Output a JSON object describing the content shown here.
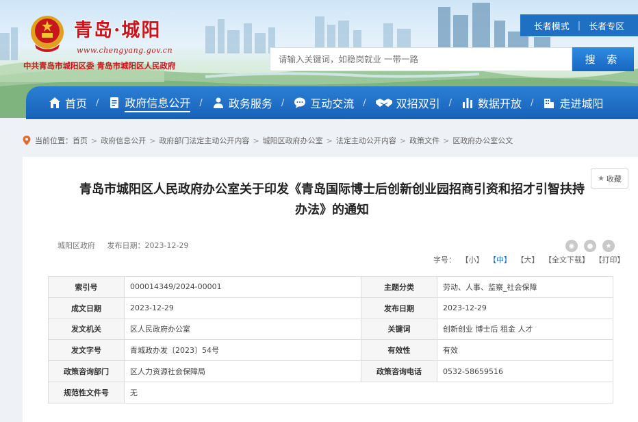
{
  "header": {
    "site_title": "青岛·城阳",
    "site_url": "www.chengyang.gov.cn",
    "site_sub": "中共青岛市城阳区委  青岛市城阳区人民政府",
    "elder_mode": "长者模式",
    "elder_zone": "长者专区",
    "search_placeholder": "请输入关键词，如稳岗就业 一带一路",
    "search_button": "搜 索"
  },
  "nav": {
    "items": [
      {
        "label": "首页",
        "icon": "home-icon"
      },
      {
        "label": "政府信息公开",
        "icon": "document-icon"
      },
      {
        "label": "政务服务",
        "icon": "service-icon"
      },
      {
        "label": "互动交流",
        "icon": "chat-icon"
      },
      {
        "label": "双招双引",
        "icon": "handshake-icon"
      },
      {
        "label": "数据开放",
        "icon": "bar-chart-icon"
      },
      {
        "label": "走进城阳",
        "icon": "building-icon"
      }
    ],
    "active_index": 1
  },
  "breadcrumb": {
    "prefix": "当前位置：",
    "items": [
      "首页",
      "政府信息公开",
      "政府部门法定主动公开内容",
      "城阳区政府办公室",
      "法定主动公开内容",
      "政策文件",
      "区政府办公室公文"
    ]
  },
  "article": {
    "title": "青岛市城阳区人民政府办公室关于印发《青岛国际博士后创新创业园招商引资和招才引智扶持办法》的通知",
    "source": "城阳区政府",
    "publish_date": "发布日期：2023-12-29",
    "favorite": "收藏",
    "font_size_label": "字号：",
    "font_small": "【小】",
    "font_medium": "【中】",
    "font_large": "【大】",
    "download": "【全文下载】",
    "print": "【打印】"
  },
  "info_table": {
    "rows": [
      [
        "索引号",
        "000014349/2024-00001",
        "主题分类",
        "劳动、人事、监察_社会保障"
      ],
      [
        "成文日期",
        "2023-12-29",
        "发布日期",
        "2023-12-29"
      ],
      [
        "发文机关",
        "区人民政府办公室",
        "关键词",
        "创新创业 博士后 租金 人才"
      ],
      [
        "发文字号",
        "青城政办发〔2023〕54号",
        "有效性",
        "有效"
      ],
      [
        "政策咨询部门",
        "区人力资源社会保障局",
        "政策咨询电话",
        "0532-58659516"
      ],
      [
        "规范性文件号",
        "无",
        "",
        ""
      ]
    ]
  },
  "colors": {
    "brand_red": "#c8161d",
    "nav_blue": "#1f6fc2",
    "active_font": "#1f6fc2"
  }
}
